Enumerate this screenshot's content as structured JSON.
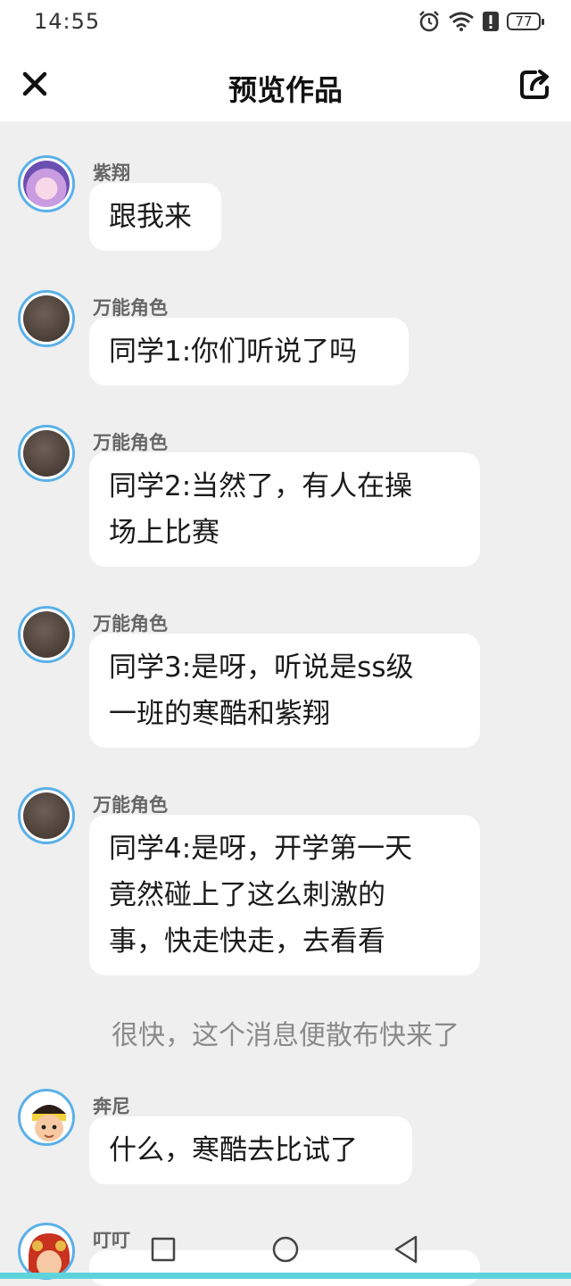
{
  "status": {
    "time": "14:55",
    "battery": "77",
    "icons": [
      "alarm-icon",
      "wifi-icon",
      "alert-icon",
      "battery-icon"
    ]
  },
  "header": {
    "title": "预览作品",
    "close_icon": "close-icon",
    "share_icon": "share-icon"
  },
  "messages": [
    {
      "sender": "紫翔",
      "text": [
        "跟我来"
      ],
      "avatar": "anime-girl-avatar"
    },
    {
      "sender": "万能角色",
      "text": [
        "同学1:你们听说了吗"
      ],
      "avatar": "blank-avatar"
    },
    {
      "sender": "万能角色",
      "text": [
        "同学2:当然了，有人在操",
        "场上比赛"
      ],
      "avatar": "blank-avatar"
    },
    {
      "sender": "万能角色",
      "text": [
        "同学3:是呀，听说是ss级",
        "一班的寒酷和紫翔"
      ],
      "avatar": "blank-avatar"
    },
    {
      "sender": "万能角色",
      "text": [
        "同学4:是呀，开学第一天",
        "竟然碰上了这么刺激的",
        "事，快走快走，去看看"
      ],
      "avatar": "blank-avatar"
    },
    {
      "sender": "奔尼",
      "text": [
        "什么，寒酷去比试了"
      ],
      "avatar": "cartoon-boy-avatar"
    },
    {
      "sender": "叮叮",
      "text": [
        ""
      ],
      "avatar": "cartoon-girl-avatar"
    }
  ],
  "narration": "很快，这个消息便散布快来了",
  "navbar": [
    "recent-apps-icon",
    "home-icon",
    "back-icon"
  ],
  "colors": {
    "background": "#efefef",
    "avatar_border": "#5ab0e8",
    "bubble": "#ffffff",
    "bottom_strip": "#5fd3dc"
  }
}
